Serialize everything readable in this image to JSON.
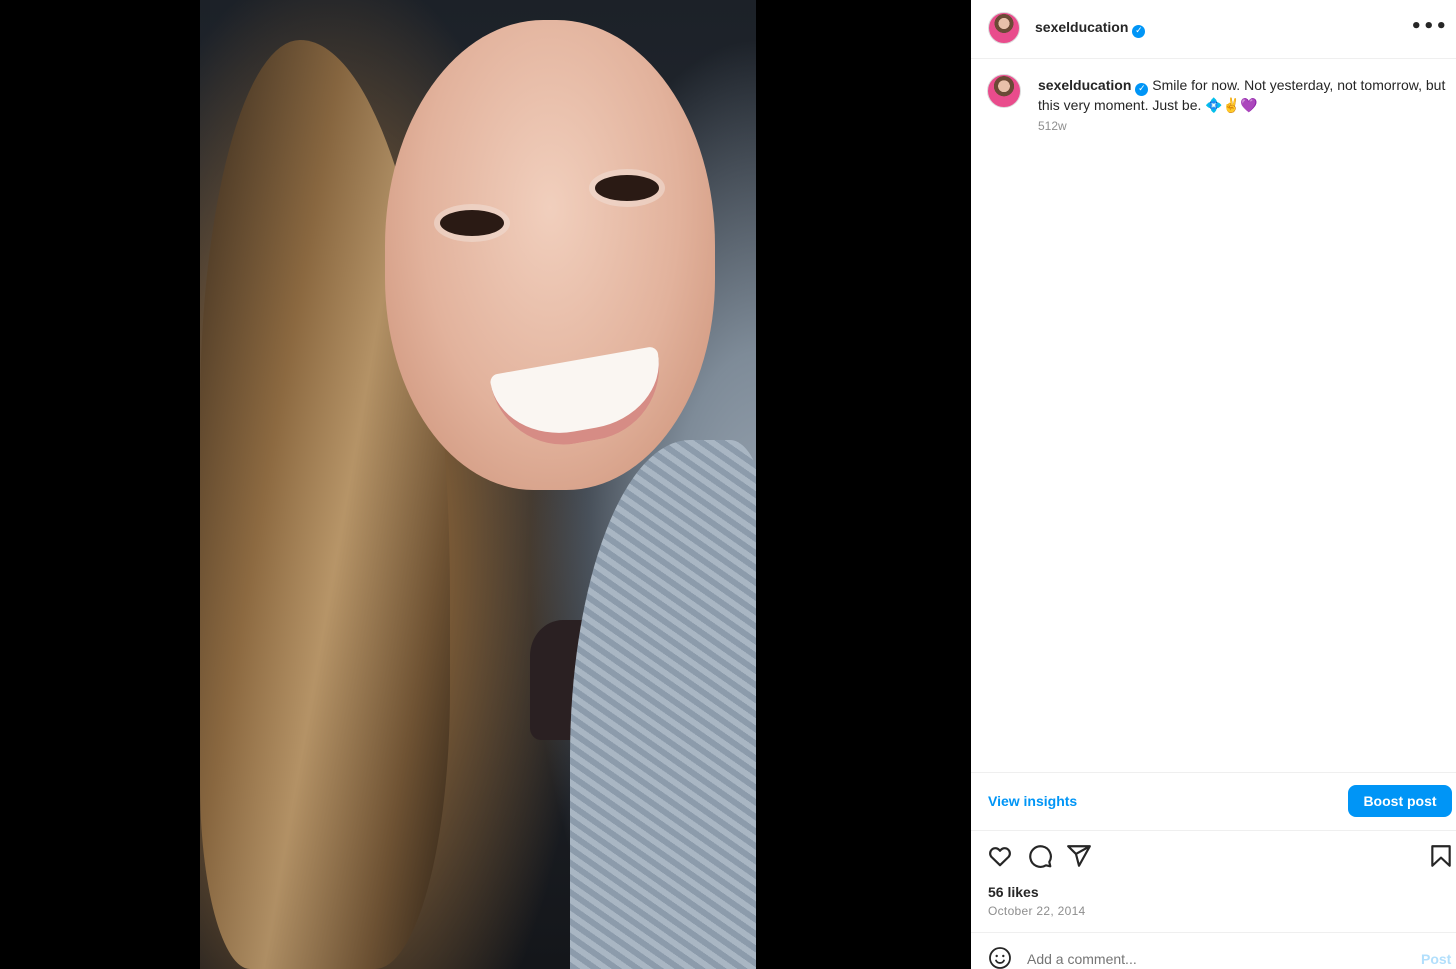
{
  "post": {
    "username": "sexelducation",
    "verified": true,
    "more_glyph": "•••",
    "caption_text": "Smile for now. Not yesterday, not tomorrow, but this very moment. Just be.",
    "caption_emoji": "💠✌️💜",
    "time_ago": "512w",
    "likes": "56 likes",
    "date": "October 22, 2014"
  },
  "actions": {
    "view_insights": "View insights",
    "boost_post": "Boost post",
    "icons": [
      "heart-icon",
      "comment-icon",
      "share-icon",
      "bookmark-icon"
    ]
  },
  "comment": {
    "placeholder": "Add a comment...",
    "post_label": "Post"
  },
  "colors": {
    "accent": "#0095f6",
    "text": "#262626",
    "muted": "#8e8e8e",
    "post_disabled": "#b2dffc"
  }
}
